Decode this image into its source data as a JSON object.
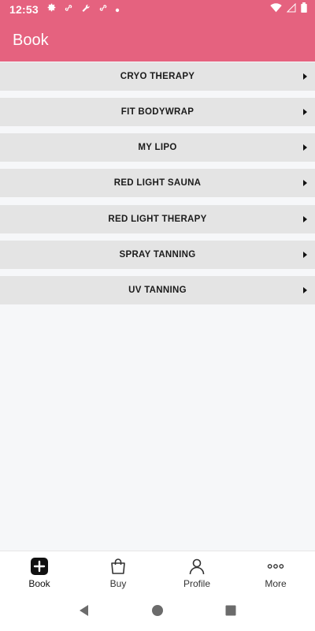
{
  "status_bar": {
    "time": "12:53"
  },
  "app_bar": {
    "title": "Book"
  },
  "services": [
    {
      "label": "CRYO THERAPY"
    },
    {
      "label": "FIT BODYWRAP"
    },
    {
      "label": "MY LIPO"
    },
    {
      "label": "RED LIGHT SAUNA"
    },
    {
      "label": "RED LIGHT THERAPY"
    },
    {
      "label": "SPRAY TANNING"
    },
    {
      "label": "UV TANNING"
    }
  ],
  "bottom_nav": {
    "items": [
      {
        "label": "Book",
        "icon": "plus-square-icon",
        "active": true
      },
      {
        "label": "Buy",
        "icon": "shopping-bag-icon",
        "active": false
      },
      {
        "label": "Profile",
        "icon": "person-icon",
        "active": false
      },
      {
        "label": "More",
        "icon": "more-dots-icon",
        "active": false
      }
    ]
  },
  "colors": {
    "brand": "#e5627f",
    "row_background": "#e4e4e4",
    "page_background": "#f6f7f9"
  }
}
